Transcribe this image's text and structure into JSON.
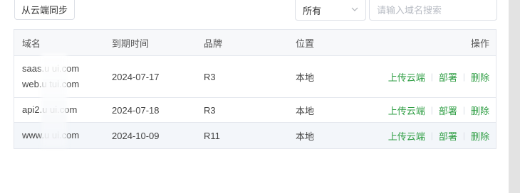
{
  "toolbar": {
    "sync_label": "从云端同步",
    "filter_selected": "所有",
    "search_placeholder": "请输入域名搜索"
  },
  "table": {
    "headers": {
      "domain": "域名",
      "expire": "到期时间",
      "brand": "品牌",
      "location": "位置",
      "ops": "操作"
    },
    "rows": [
      {
        "domains": [
          "saas.u   ui.com",
          "web.u   tui.com"
        ],
        "expire": "2024-07-17",
        "brand": "R3",
        "location": "本地"
      },
      {
        "domains": [
          "api2.u   ui.com"
        ],
        "expire": "2024-07-18",
        "brand": "R3",
        "location": "本地"
      },
      {
        "domains": [
          "www.u   ui.com"
        ],
        "expire": "2024-10-09",
        "brand": "R11",
        "location": "本地"
      }
    ],
    "actions": {
      "upload": "上传云端",
      "deploy": "部署",
      "delete": "删除"
    }
  },
  "colors": {
    "action_link": "#2f9e44",
    "border": "#e4e7ed",
    "header_bg": "#f7f8fa"
  },
  "icons": {
    "dropdown": "chevron-down-icon",
    "search": "search-icon"
  }
}
